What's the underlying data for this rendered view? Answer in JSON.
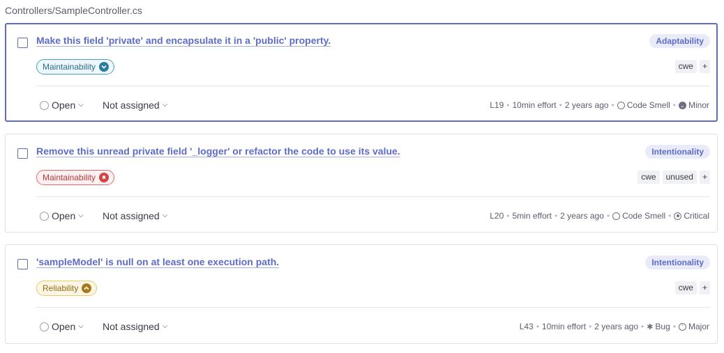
{
  "file_path": "Controllers/SampleController.cs",
  "issues": [
    {
      "title": "Make this field 'private' and encapsulate it in a 'public' property.",
      "attribute": "Adaptability",
      "quality": "Maintainability",
      "quality_severity_icon": "chevron-down",
      "tags": [
        "cwe",
        "+"
      ],
      "status": "Open",
      "assignee": "Not assigned",
      "line": "L19",
      "effort": "10min effort",
      "age": "2 years ago",
      "type": "Code Smell",
      "severity": "Minor",
      "selected": true
    },
    {
      "title": "Remove this unread private field '_logger' or refactor the code to use its value.",
      "attribute": "Intentionality",
      "quality": "Maintainability",
      "quality_severity_icon": "blocker",
      "tags": [
        "cwe",
        "unused",
        "+"
      ],
      "status": "Open",
      "assignee": "Not assigned",
      "line": "L20",
      "effort": "5min effort",
      "age": "2 years ago",
      "type": "Code Smell",
      "severity": "Critical",
      "selected": false
    },
    {
      "title": "'sampleModel' is null on at least one execution path.",
      "attribute": "Intentionality",
      "quality": "Reliability",
      "quality_severity_icon": "chevron-up",
      "tags": [
        "cwe",
        "+"
      ],
      "status": "Open",
      "assignee": "Not assigned",
      "line": "L43",
      "effort": "10min effort",
      "age": "2 years ago",
      "type": "Bug",
      "severity": "Major",
      "selected": false
    }
  ],
  "colors": {
    "accent": "#5d6cc6",
    "maintainability_blue": "#2d7aa3",
    "maintainability_red": "#d64545",
    "reliability": "#a67a1c"
  }
}
